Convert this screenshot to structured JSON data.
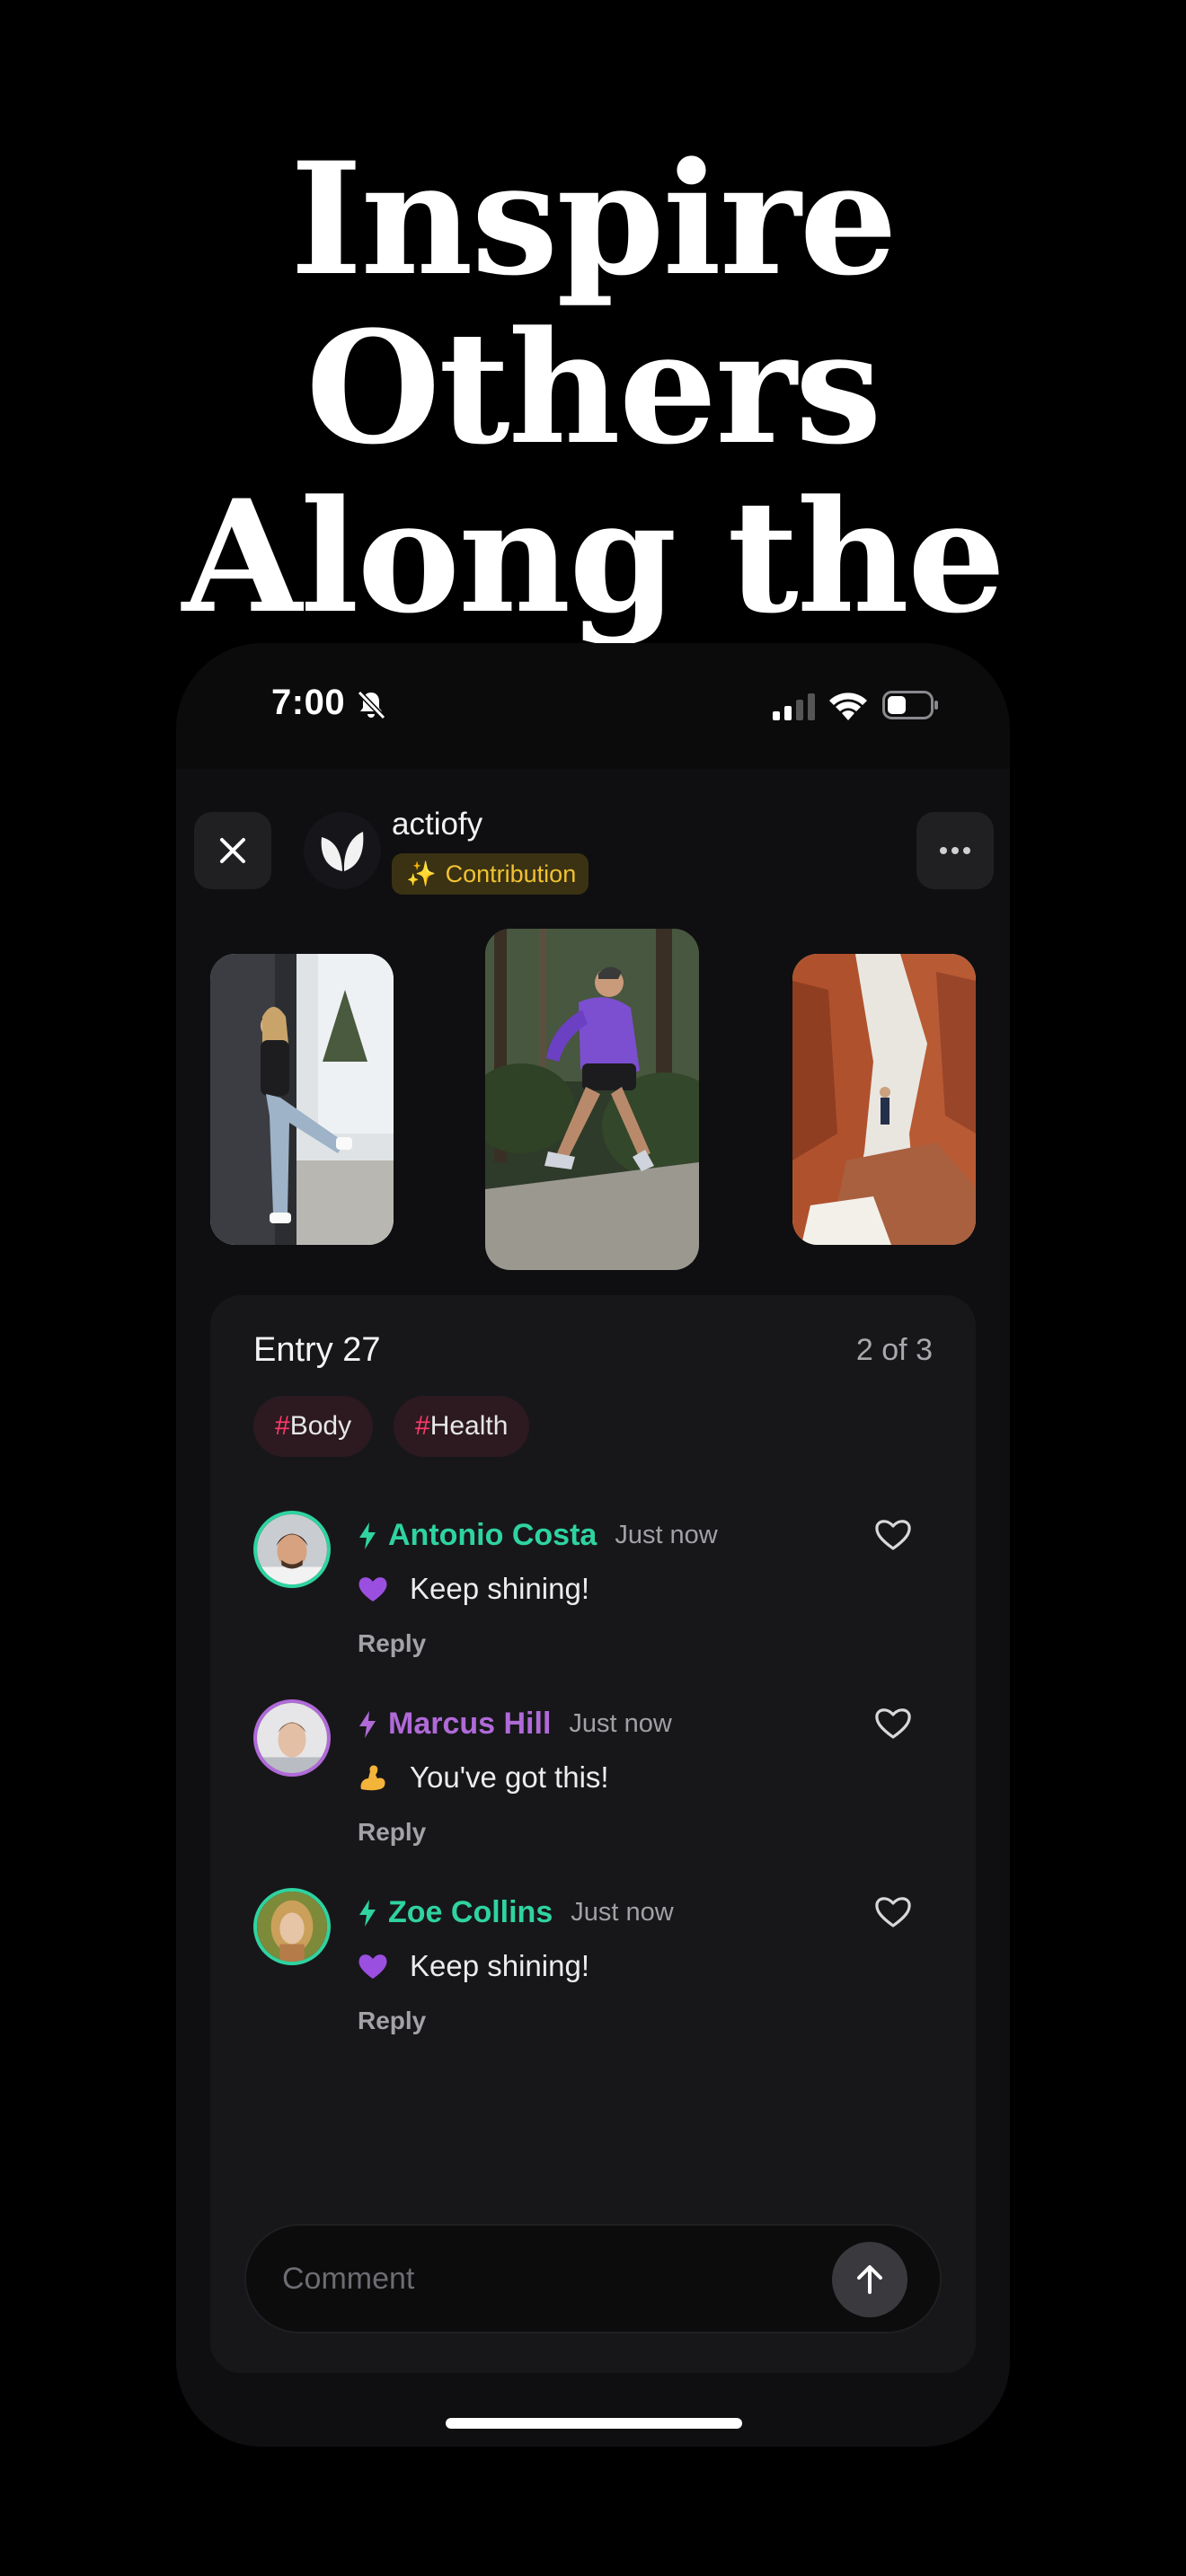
{
  "headline": {
    "line1": "Inspire Others",
    "line2": "Along the Way."
  },
  "status_bar": {
    "time": "7:00"
  },
  "header": {
    "app_name": "actiofy",
    "badge_icon": "✨",
    "badge_label": "Contribution"
  },
  "entry": {
    "title": "Entry 27",
    "count": "2 of 3"
  },
  "tags": [
    {
      "hash": "#",
      "label": "Body"
    },
    {
      "hash": "#",
      "label": "Health"
    }
  ],
  "comments": [
    {
      "name": "Antonio Costa",
      "time": "Just now",
      "emoji": "purple-heart",
      "text": "Keep shining!",
      "reply": "Reply",
      "name_color": "#2fd3a0"
    },
    {
      "name": "Marcus Hill",
      "time": "Just now",
      "emoji": "flexed-biceps",
      "text": "You've got this!",
      "reply": "Reply",
      "name_color": "#b06ad8"
    },
    {
      "name": "Zoe Collins",
      "time": "Just now",
      "emoji": "purple-heart",
      "text": "Keep shining!",
      "reply": "Reply",
      "name_color": "#2fd3a0"
    }
  ],
  "composer": {
    "placeholder": "Comment"
  },
  "colors": {
    "accent_green": "#2fd3a0",
    "accent_purple": "#b06ad8",
    "badge_text": "#f1c232",
    "tag_hash": "#ff3b6b"
  }
}
